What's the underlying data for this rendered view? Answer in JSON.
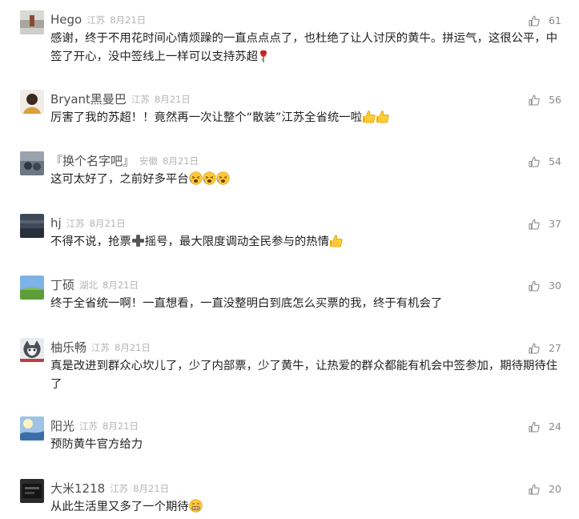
{
  "comments": [
    {
      "name": "Hego",
      "location": "江苏",
      "date": "8月21日",
      "likes": "61",
      "text": "感谢，终于不用花时间心情烦躁的一直点点点了，也杜绝了让人讨厌的黄牛。拼运气，这很公平，中签了开心，没中签线上一样可以支持苏超",
      "emoji": [
        "rose"
      ]
    },
    {
      "name": "Bryant黑曼巴",
      "location": "江苏",
      "date": "8月21日",
      "likes": "56",
      "text": "厉害了我的苏超！！竟然再一次让整个“散装”江苏全省统一啦",
      "emoji": [
        "thumbs-up",
        "thumbs-up"
      ]
    },
    {
      "name": "『换个名字吧』",
      "location": "安徽",
      "date": "8月21日",
      "likes": "54",
      "text": "这可太好了，之前好多平台",
      "emoji": [
        "tired-face",
        "tired-face",
        "tired-face"
      ]
    },
    {
      "name": "hj",
      "location": "江苏",
      "date": "8月21日",
      "likes": "37",
      "text_before": "不得不说，抢票",
      "text_after": "摇号，最大限度调动全民参与的热情",
      "emoji": [
        "thumbs-up"
      ]
    },
    {
      "name": "丁硕",
      "location": "湖北",
      "date": "8月21日",
      "likes": "30",
      "text": "终于全省统一啊！一直想看，一直没整明白到底怎么买票的我，终于有机会了"
    },
    {
      "name": "柚乐畅",
      "location": "江苏",
      "date": "8月21日",
      "likes": "27",
      "text": "真是改进到群众心坎儿了，少了内部票，少了黄牛，让热爱的群众都能有机会中签参加，期待期待住了"
    },
    {
      "name": "阳光",
      "location": "江苏",
      "date": "8月21日",
      "likes": "24",
      "text": "预防黄牛官方给力"
    },
    {
      "name": "大米1218",
      "location": "江苏",
      "date": "8月21日",
      "likes": "20",
      "text": "从此生活里又多了一个期待",
      "emoji": [
        "grin-face"
      ]
    }
  ]
}
